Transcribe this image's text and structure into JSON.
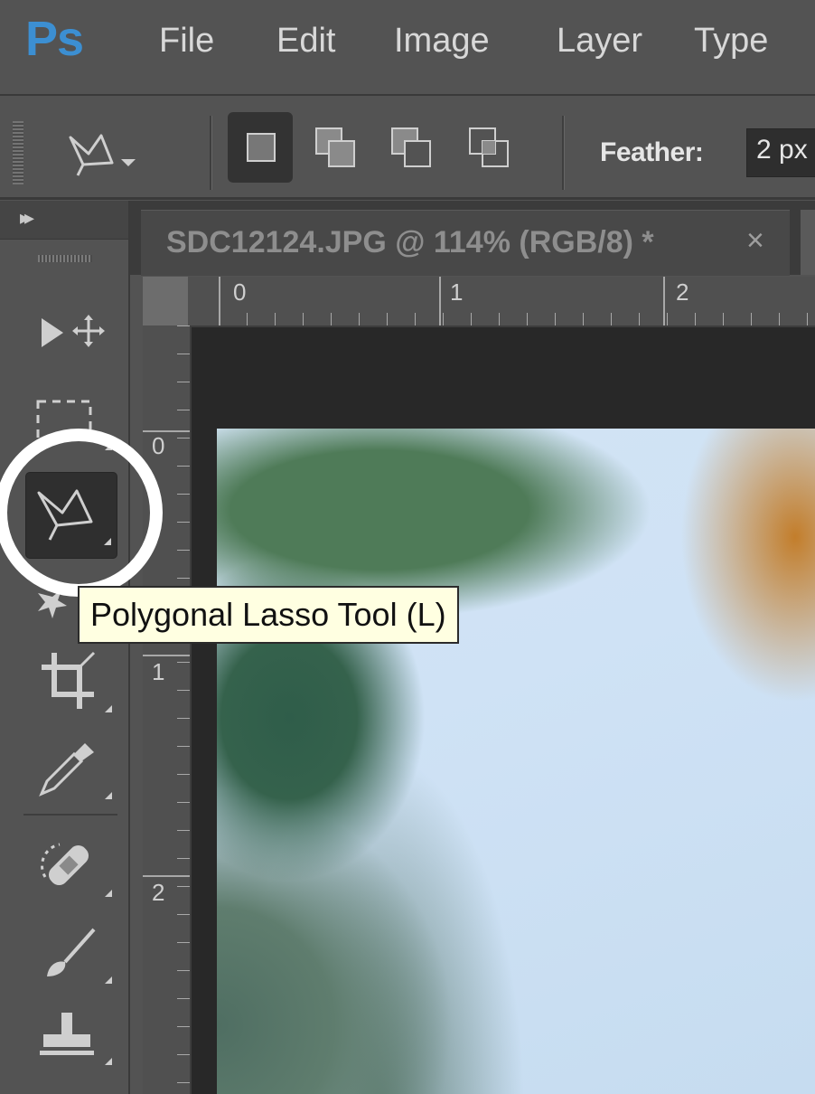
{
  "app": {
    "logo": "Ps",
    "brand_color": "#3c8fd2"
  },
  "menu": {
    "items": [
      "File",
      "Edit",
      "Image",
      "Layer",
      "Type"
    ]
  },
  "options_bar": {
    "tool_icon": "polygonal-lasso-icon",
    "selection_modes": [
      {
        "icon": "new-selection-icon",
        "active": true
      },
      {
        "icon": "add-to-selection-icon",
        "active": false
      },
      {
        "icon": "subtract-from-selection-icon",
        "active": false
      },
      {
        "icon": "intersect-selection-icon",
        "active": false
      }
    ],
    "feather_label": "Feather:",
    "feather_value": "2 px"
  },
  "document": {
    "tab_title": "SDC12124.JPG @ 114% (RGB/8) *",
    "close_glyph": "×",
    "ruler_h_labels": [
      "0",
      "1",
      "2"
    ],
    "ruler_v_labels": [
      "0",
      "1",
      "2"
    ]
  },
  "toolbox": {
    "collapse_glyph": "▸▸",
    "tools": [
      {
        "name": "move-tool",
        "icon": "move-icon",
        "active": false
      },
      {
        "name": "marquee-tool",
        "icon": "rectangular-marquee-icon",
        "active": false
      },
      {
        "name": "polygonal-lasso-tool",
        "icon": "polygonal-lasso-icon",
        "active": true
      },
      {
        "name": "quick-selection-tool",
        "icon": "magic-wand-icon",
        "active": false
      },
      {
        "name": "crop-tool",
        "icon": "crop-icon",
        "active": false
      },
      {
        "name": "eyedropper-tool",
        "icon": "eyedropper-icon",
        "active": false
      },
      {
        "name": "healing-brush-tool",
        "icon": "bandage-icon",
        "active": false
      },
      {
        "name": "brush-tool",
        "icon": "brush-icon",
        "active": false
      },
      {
        "name": "clone-stamp-tool",
        "icon": "stamp-icon",
        "active": false
      }
    ]
  },
  "tooltip": {
    "text": "Polygonal Lasso Tool (L)"
  },
  "colors": {
    "ui_background": "#535353",
    "canvas_background": "#282828",
    "tooltip_background": "#ffffe1",
    "highlight_ring": "#ffffff"
  }
}
